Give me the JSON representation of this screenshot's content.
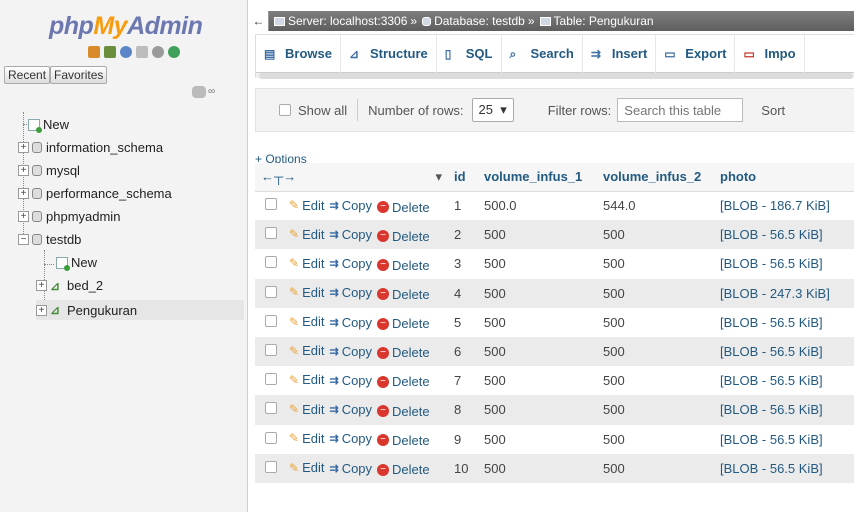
{
  "nav": {
    "logo": {
      "php": "php",
      "my": "My",
      "admin": "Admin"
    },
    "toolbar_icons": [
      "home-icon",
      "sql-icon",
      "help-icon",
      "docs-icon",
      "settings-icon",
      "reload-icon"
    ],
    "recent_label": "Recent",
    "favorites_label": "Favorites",
    "tree": [
      {
        "label": "New",
        "type": "new"
      },
      {
        "label": "information_schema",
        "type": "db"
      },
      {
        "label": "mysql",
        "type": "db"
      },
      {
        "label": "performance_schema",
        "type": "db"
      },
      {
        "label": "phpmyadmin",
        "type": "db"
      },
      {
        "label": "testdb",
        "type": "db",
        "expanded": true
      },
      {
        "label": "New",
        "type": "new-child"
      },
      {
        "label": "bed_2",
        "type": "table"
      },
      {
        "label": "Pengukuran",
        "type": "table",
        "active": true
      }
    ]
  },
  "breadcrumb": {
    "server": "Server: localhost:3306",
    "database": "Database: testdb",
    "table": "Table: Pengukuran",
    "separator": "»"
  },
  "tabs": [
    "Browse",
    "Structure",
    "SQL",
    "Search",
    "Insert",
    "Export",
    "Impo"
  ],
  "filter": {
    "show_all": "Show all",
    "number_of_rows_label": "Number of rows:",
    "rows_value": "25",
    "filter_rows_label": "Filter rows:",
    "search_placeholder": "Search this table",
    "sort_label": "Sort"
  },
  "options_link": "+ Options",
  "table": {
    "columns": [
      "id",
      "volume_infus_1",
      "volume_infus_2",
      "photo"
    ],
    "action_labels": {
      "edit": "Edit",
      "copy": "Copy",
      "delete": "Delete"
    },
    "rows": [
      {
        "id": "1",
        "v1": "500.0",
        "v2": "544.0",
        "photo": "[BLOB - 186.7 KiB]"
      },
      {
        "id": "2",
        "v1": "500",
        "v2": "500",
        "photo": "[BLOB - 56.5 KiB]"
      },
      {
        "id": "3",
        "v1": "500",
        "v2": "500",
        "photo": "[BLOB - 56.5 KiB]"
      },
      {
        "id": "4",
        "v1": "500",
        "v2": "500",
        "photo": "[BLOB - 247.3 KiB]"
      },
      {
        "id": "5",
        "v1": "500",
        "v2": "500",
        "photo": "[BLOB - 56.5 KiB]"
      },
      {
        "id": "6",
        "v1": "500",
        "v2": "500",
        "photo": "[BLOB - 56.5 KiB]"
      },
      {
        "id": "7",
        "v1": "500",
        "v2": "500",
        "photo": "[BLOB - 56.5 KiB]"
      },
      {
        "id": "8",
        "v1": "500",
        "v2": "500",
        "photo": "[BLOB - 56.5 KiB]"
      },
      {
        "id": "9",
        "v1": "500",
        "v2": "500",
        "photo": "[BLOB - 56.5 KiB]"
      },
      {
        "id": "10",
        "v1": "500",
        "v2": "500",
        "photo": "[BLOB - 56.5 KiB]"
      }
    ]
  }
}
